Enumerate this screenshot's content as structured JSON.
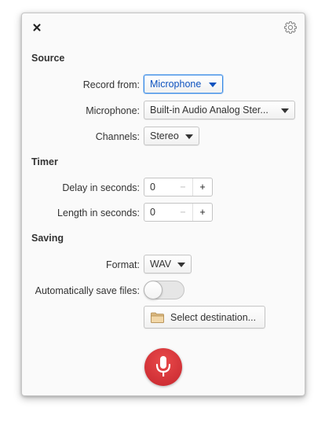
{
  "sections": {
    "source": "Source",
    "timer": "Timer",
    "saving": "Saving"
  },
  "source": {
    "record_from_label": "Record from:",
    "record_from_value": "Microphone",
    "microphone_label": "Microphone:",
    "microphone_value": "Built-in Audio Analog Ster...",
    "channels_label": "Channels:",
    "channels_value": "Stereo"
  },
  "timer": {
    "delay_label": "Delay in seconds:",
    "delay_value": "0",
    "length_label": "Length in seconds:",
    "length_value": "0"
  },
  "saving": {
    "format_label": "Format:",
    "format_value": "WAV",
    "autosave_label": "Automatically save files:",
    "autosave_on": false,
    "destination_label": "Select destination..."
  },
  "spin": {
    "minus": "−",
    "plus": "+"
  },
  "icons": {
    "close": "close-icon",
    "settings": "gear-icon",
    "folder": "folder-icon",
    "microphone": "microphone-icon"
  },
  "colors": {
    "accent": "#3689e6",
    "record": "#c6262e"
  }
}
